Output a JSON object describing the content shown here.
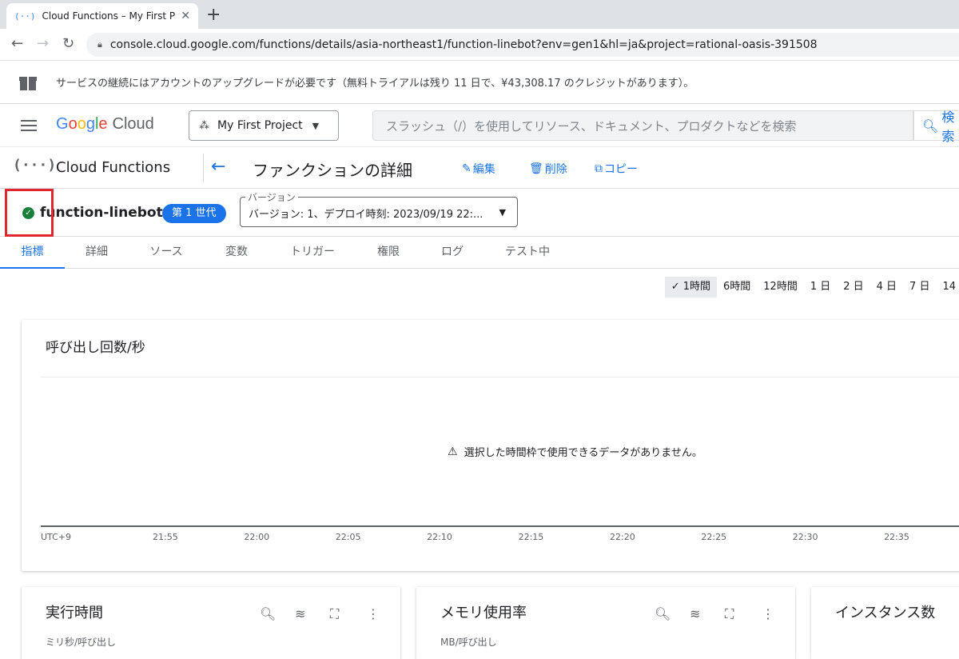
{
  "browser": {
    "tab_title": "Cloud Functions – My First Project",
    "tab_favicon": "(··)",
    "url": "console.cloud.google.com/functions/details/asia-northeast1/function-linebot?env=gen1&hl=ja&project=rational-oasis-391508"
  },
  "notice": {
    "text": "サービスの継続にはアカウントのアップグレードが必要です（無料トライアルは残り 11 日で、¥43,308.17 のクレジットがあります）。"
  },
  "header": {
    "logo_google": [
      "G",
      "o",
      "o",
      "g",
      "l",
      "e"
    ],
    "logo_cloud": "Cloud",
    "project": "My First Project",
    "search_placeholder": "スラッシュ（/）を使用してリソース、ドキュメント、プロダクトなどを検索",
    "search_button": "検索"
  },
  "product": {
    "name": "Cloud Functions",
    "page_title": "ファンクションの詳細",
    "actions": {
      "edit": "編集",
      "delete": "削除",
      "copy": "コピー"
    }
  },
  "function": {
    "name": "function-linebot",
    "generation": "第 1 世代",
    "version_legend": "バージョン",
    "version_value": "バージョン: 1、デプロイ時刻: 2023/09/19 22:..."
  },
  "tabs": [
    "指標",
    "詳細",
    "ソース",
    "変数",
    "トリガー",
    "権限",
    "ログ",
    "テスト中"
  ],
  "time_ranges": [
    "1時間",
    "6時間",
    "12時間",
    "1 日",
    "2 日",
    "4 日",
    "7 日",
    "14"
  ],
  "chart": {
    "title": "呼び出し回数/秒",
    "empty_message": "選択した時間枠で使用できるデータがありません。",
    "timezone": "UTC+9"
  },
  "chart_data": {
    "type": "line",
    "title": "呼び出し回数/秒",
    "x": [
      "21:55",
      "22:00",
      "22:05",
      "22:10",
      "22:15",
      "22:20",
      "22:25",
      "22:30",
      "22:35"
    ],
    "series": []
  },
  "bottom_cards": [
    {
      "title": "実行時間",
      "subtitle": "ミリ秒/呼び出し"
    },
    {
      "title": "メモリ使用率",
      "subtitle": "MB/呼び出し"
    },
    {
      "title": "インスタンス数",
      "subtitle": ""
    }
  ]
}
